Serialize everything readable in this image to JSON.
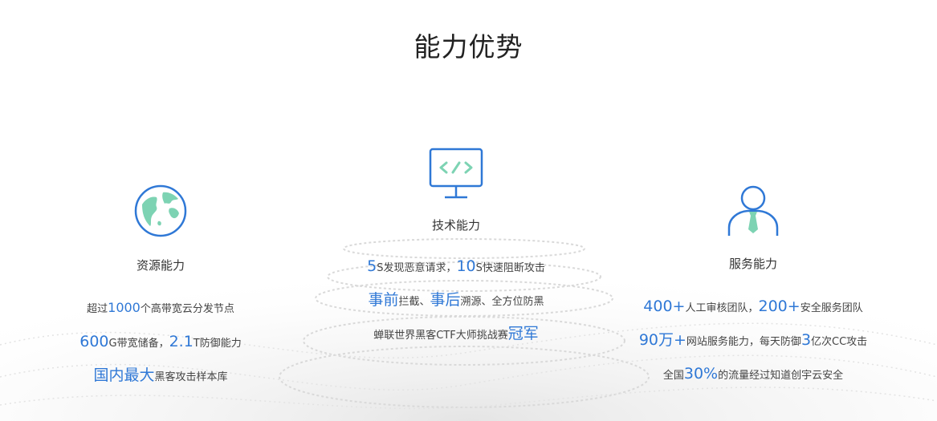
{
  "page": {
    "title": "能力优势"
  },
  "columns": [
    {
      "icon": "globe-icon",
      "title": "资源能力",
      "lines": [
        [
          "超过",
          "1000",
          "个高带宽云分发节点"
        ],
        [
          "",
          "600",
          "G带宽储备，",
          "2.1",
          "T防御能力"
        ],
        [
          "",
          "国内最大",
          "黑客攻击样本库"
        ]
      ]
    },
    {
      "icon": "code-monitor-icon",
      "title": "技术能力",
      "lines": [
        [
          "",
          "5",
          "S发现恶意请求，",
          "10",
          "S快速阻断攻击"
        ],
        [
          "",
          "事前",
          "拦截、",
          "事后",
          "溯源、全方位防黑"
        ],
        [
          "蝉联世界黑客CTF大师挑战赛",
          "冠军"
        ]
      ]
    },
    {
      "icon": "user-tie-icon",
      "title": "服务能力",
      "lines": [
        [
          "",
          "400+",
          "人工审核团队，",
          "200+",
          "安全服务团队"
        ],
        [
          "",
          "90万+",
          "网站服务能力，每天防御",
          "3",
          "亿次CC攻击"
        ],
        [
          "全国",
          "30%",
          "的流量经过知道创宇云安全"
        ]
      ]
    }
  ],
  "colors": {
    "accent": "#2f78d6",
    "icon_fill": "#7dd3b3",
    "text": "#333333"
  }
}
